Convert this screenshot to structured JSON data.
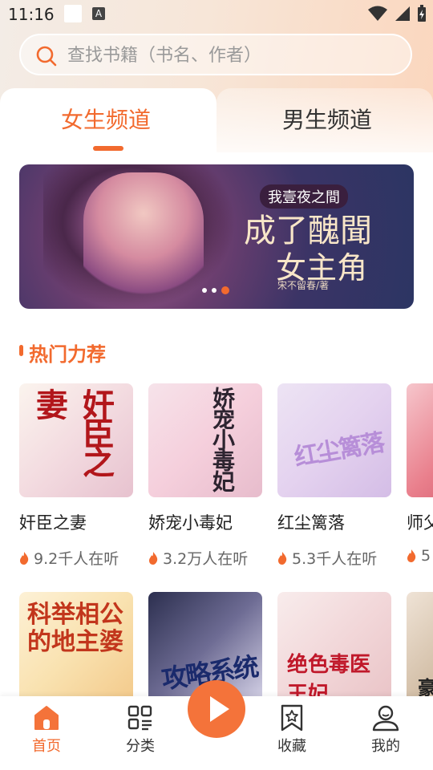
{
  "status_bar": {
    "time": "11:16",
    "a_badge": "A"
  },
  "search": {
    "placeholder": "查找书籍（书名、作者）"
  },
  "tabs": [
    {
      "label": "女生频道",
      "active": true
    },
    {
      "label": "男生频道",
      "active": false
    }
  ],
  "banner": {
    "pre_title": "我壹夜之間",
    "title_line1": "成了醜聞",
    "title_line2": "女主角",
    "author": "宋不留春/著",
    "slide_count": 3,
    "active_slide": 3
  },
  "section": {
    "title": "热门力荐"
  },
  "books_row1": [
    {
      "name": "奸臣之妻",
      "listeners": "9.2千人在听",
      "cover_text": "奸臣之妻"
    },
    {
      "name": "娇宠小毒妃",
      "listeners": "3.2万人在听",
      "cover_text": "娇宠小毒妃"
    },
    {
      "name": "红尘篱落",
      "listeners": "5.3千人在听",
      "cover_text": "红尘篱落"
    },
    {
      "name": "师父",
      "listeners": "5",
      "cover_text": ""
    }
  ],
  "books_row2": [
    {
      "cover_text": "科举相公的地主婆"
    },
    {
      "cover_text": "攻略系统"
    },
    {
      "cover_text": "绝色毒医王妃"
    },
    {
      "cover_text": "豪"
    }
  ],
  "nav": [
    {
      "label": "首页",
      "active": true
    },
    {
      "label": "分类",
      "active": false
    },
    {
      "label": "收藏",
      "active": false
    },
    {
      "label": "我的",
      "active": false
    }
  ],
  "colors": {
    "accent": "#f26a2e"
  }
}
